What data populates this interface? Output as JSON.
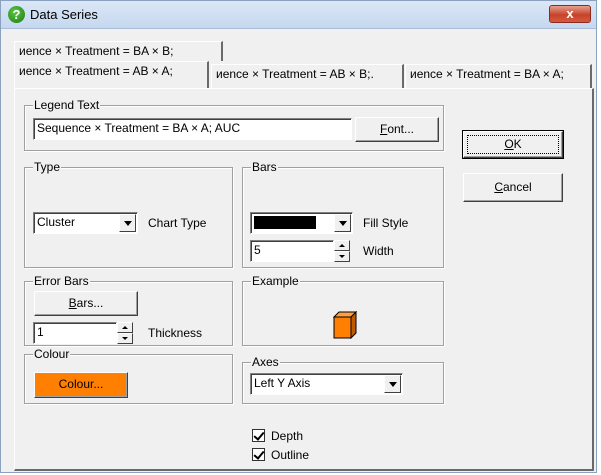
{
  "window": {
    "title": "Data Series",
    "close_glyph": "x",
    "help_glyph": "?"
  },
  "tabs": [
    "иence × Treatment = BA × B;",
    "иence × Treatment = AB × A;",
    "иence × Treatment = AB × B;.",
    "иence × Treatment = BA × A;"
  ],
  "legend": {
    "group_label": "Legend Text",
    "value": "Sequence × Treatment = BA × A; AUC",
    "font_button_pre": "",
    "font_button_ul": "F",
    "font_button_post": "ont..."
  },
  "buttons": {
    "ok_ul": "O",
    "ok_post": "K",
    "cancel_ul": "C",
    "cancel_post": "ancel"
  },
  "type_group": {
    "label": "Type",
    "selected": "Cluster",
    "caption": "Chart Type"
  },
  "bars_group": {
    "label": "Bars",
    "fill_caption": "Fill Style",
    "fill_color": "#000000",
    "width_value": "5",
    "width_caption": "Width"
  },
  "error_bars": {
    "label": "Error Bars",
    "button_ul": "B",
    "button_post": "ars...",
    "thickness_value": "1",
    "thickness_caption": "Thickness"
  },
  "example": {
    "label": "Example",
    "bar_color": "#ff8000"
  },
  "colour": {
    "label": "Colour",
    "button": "Colour...",
    "button_color": "#ff8000"
  },
  "axes": {
    "label": "Axes",
    "selected": "Left Y Axis"
  },
  "options": {
    "depth": "Depth",
    "outline": "Outline",
    "depth_checked": true,
    "outline_checked": true
  }
}
